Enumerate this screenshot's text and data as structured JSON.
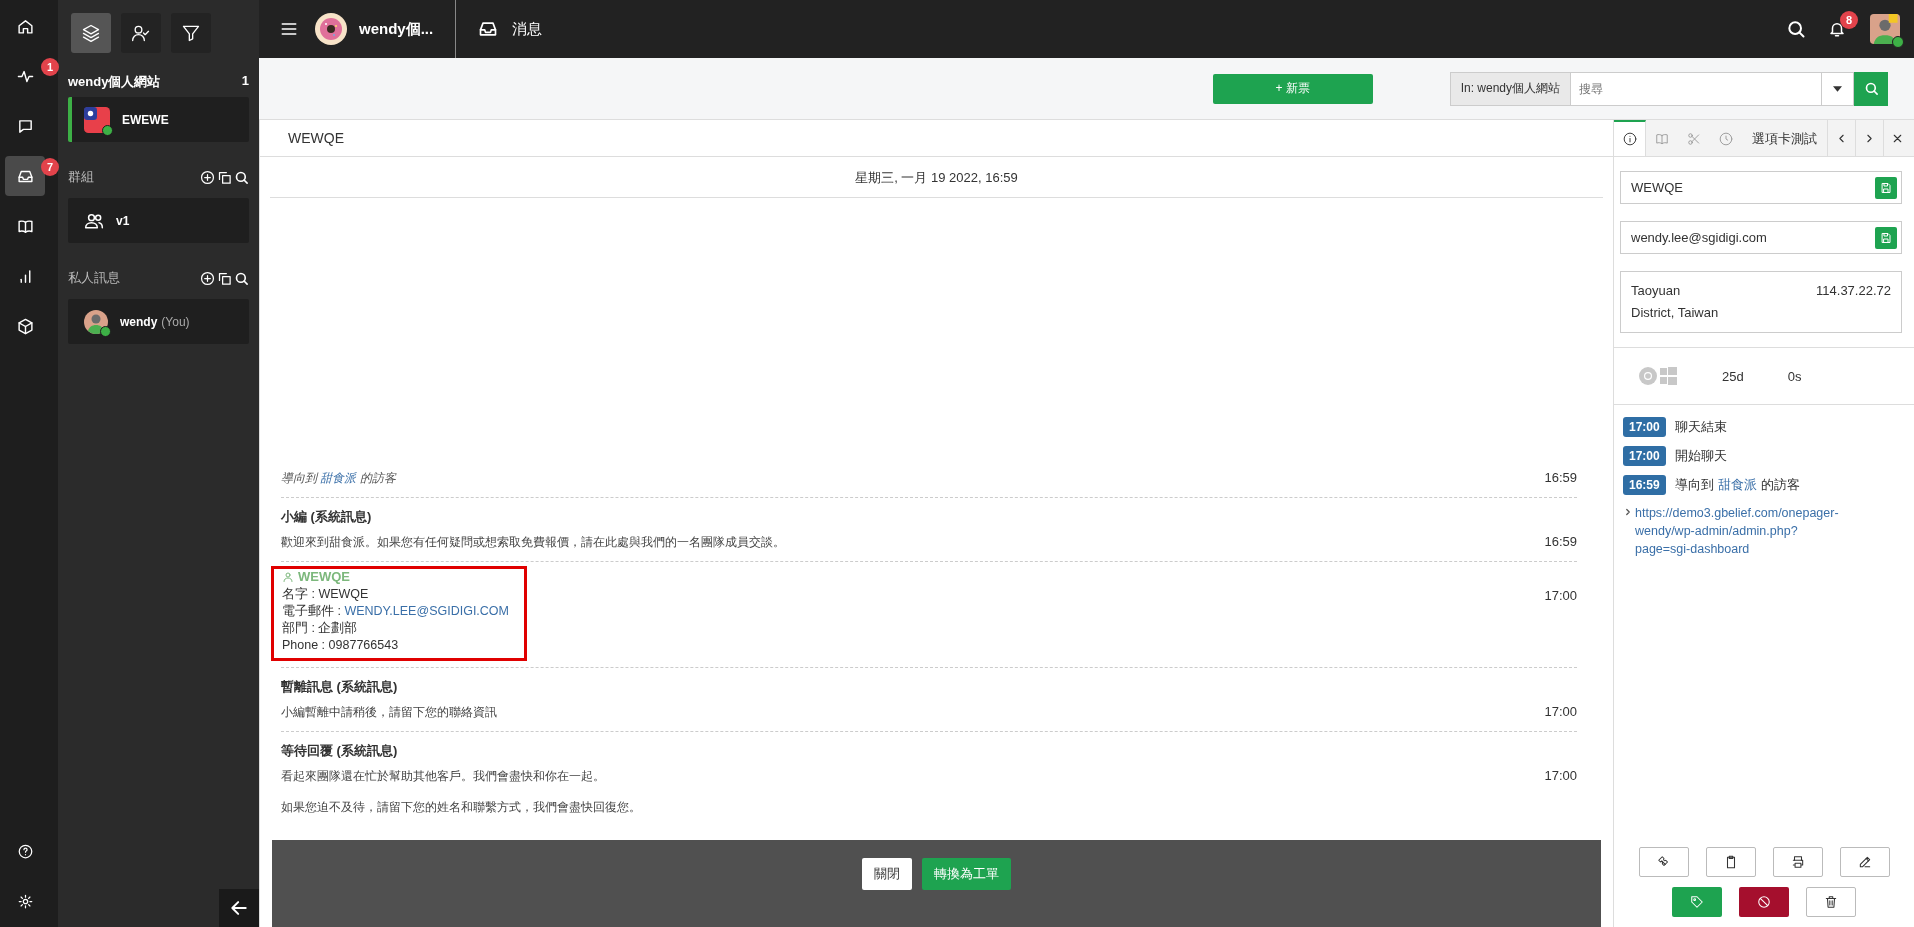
{
  "rail": {
    "items": [
      {
        "kind": "home",
        "selected": false
      },
      {
        "kind": "pulse",
        "selected": false,
        "badge": "1"
      },
      {
        "kind": "chat",
        "selected": false
      },
      {
        "kind": "inbox",
        "selected": true,
        "badge": "7"
      },
      {
        "kind": "book",
        "selected": false
      },
      {
        "kind": "chart",
        "selected": false
      },
      {
        "kind": "cube",
        "selected": false
      }
    ],
    "bottom": [
      {
        "kind": "help"
      },
      {
        "kind": "gear"
      }
    ]
  },
  "panel": {
    "tools": [
      {
        "kind": "layers",
        "selected": true
      },
      {
        "kind": "user-check",
        "selected": false
      },
      {
        "kind": "filter",
        "selected": false
      }
    ],
    "site": {
      "name": "wendy個人網站",
      "count": "1",
      "items": [
        {
          "name": "EWEWE",
          "active": true,
          "online": true
        }
      ]
    },
    "sections": [
      {
        "title": "群組",
        "items": [
          {
            "kind": "group",
            "name": "v1"
          }
        ]
      },
      {
        "title": "私人訊息",
        "items": [
          {
            "kind": "user",
            "name": "wendy",
            "suffix": "(You)",
            "online": true
          }
        ]
      }
    ]
  },
  "topbar": {
    "brand": "wendy個...",
    "section": "消息",
    "notifications": "8"
  },
  "toolbar": {
    "new_button": "+ 新票",
    "scope": "In: wendy個人網站",
    "search": {
      "placeholder": "搜尋"
    }
  },
  "conversation": {
    "tab": "WEWQE",
    "date": "星期三, 一月 19 2022, 16:59",
    "messages": [
      {
        "kind": "event",
        "text": "導向到",
        "link": "甜食派",
        "after": "的訪客",
        "time": "16:59"
      },
      {
        "kind": "system",
        "title": "小編 (系統訊息)",
        "body": [
          "歡迎來到甜食派。如果您有任何疑問或想索取免費報價，請在此處與我們的一名團隊成員交談。"
        ],
        "time": "16:59"
      },
      {
        "kind": "contact",
        "name": "WEWQE",
        "highlighted": true,
        "time": "17:00",
        "fields": [
          {
            "label": "名字 :",
            "value": "WEWQE",
            "link": false
          },
          {
            "label": "電子郵件 :",
            "value": "WENDY.LEE@SGIDIGI.COM",
            "link": true
          },
          {
            "label": "部門 :",
            "value": "企劃部",
            "link": false
          },
          {
            "label": "Phone :",
            "value": "0987766543",
            "link": false
          }
        ]
      },
      {
        "kind": "system",
        "title": "暫離訊息 (系統訊息)",
        "body": [
          "小編暫離中請稍後，請留下您的聯絡資訊"
        ],
        "time": "17:00"
      },
      {
        "kind": "system",
        "title": "等待回覆 (系統訊息)",
        "body": [
          "看起來團隊還在忙於幫助其他客戶。我們會盡快和你在一起。",
          "如果您迫不及待，請留下您的姓名和聯繫方式，我們會盡快回復您。"
        ],
        "time": "17:00"
      }
    ]
  },
  "bottom_bar": {
    "buttons": [
      {
        "kind": "plain",
        "label": "關閉"
      },
      {
        "kind": "primary",
        "label": "轉換為工單"
      }
    ]
  },
  "side": {
    "tabs": [
      {
        "kind": "info",
        "selected": true
      },
      {
        "kind": "book",
        "selected": false
      },
      {
        "kind": "cut",
        "selected": false
      },
      {
        "kind": "history",
        "selected": false
      },
      {
        "kind": "text",
        "label": "選項卡測試",
        "selected": false
      }
    ],
    "fields": [
      {
        "value": "WEWQE"
      },
      {
        "value": "wendy.lee@sgidigi.com"
      }
    ],
    "location": "Taoyuan District, Taiwan",
    "ip": "114.37.22.72",
    "stats": [
      "25d",
      "0s"
    ],
    "events": [
      {
        "time": "17:00",
        "text": "聊天結束"
      },
      {
        "time": "17:00",
        "text": "開始聊天"
      },
      {
        "time": "16:59",
        "text": "導向到",
        "link": "甜食派",
        "after": "的訪客"
      }
    ],
    "url": "https://demo3.gbelief.com/onepager-wendy/wp-admin/admin.php?page=sgi-dashboard",
    "actions": [
      [
        {
          "kind": "ticket"
        },
        {
          "kind": "clipboard"
        },
        {
          "kind": "printer"
        },
        {
          "kind": "edit"
        }
      ],
      [
        {
          "kind": "tag"
        },
        {
          "kind": "ban"
        },
        {
          "kind": "trash"
        }
      ]
    ]
  }
}
